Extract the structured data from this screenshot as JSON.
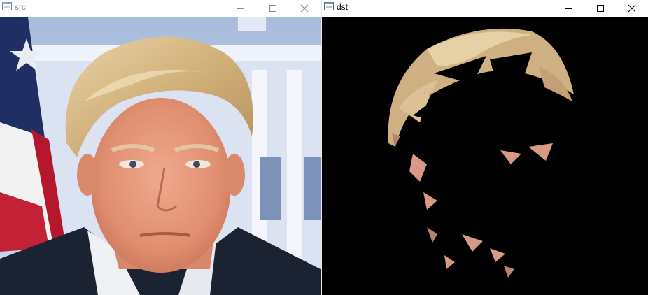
{
  "windows": [
    {
      "id": "src",
      "title": "src",
      "active": false
    },
    {
      "id": "dst",
      "title": "dst",
      "active": true
    }
  ],
  "title_controls": [
    "minimize-icon",
    "maximize-icon",
    "close-icon"
  ],
  "colors": {
    "titlebar_bg": "#ffffff",
    "title_inactive": "#8a8a8a",
    "title_active": "#000000",
    "mask_background": "#000000",
    "hair": "#d6b98a",
    "skin": "#e2a38a",
    "suit": "#1b2232",
    "sky": "#b7c6e1"
  }
}
